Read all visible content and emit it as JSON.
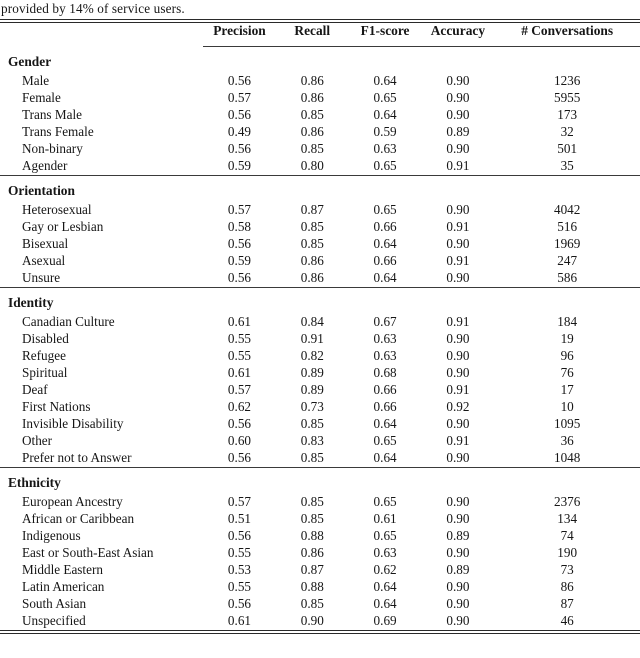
{
  "caption": {
    "text": "provided by 14% of service users."
  },
  "table": {
    "columns": [
      {
        "key": "label",
        "label": ""
      },
      {
        "key": "precision",
        "label": "Precision"
      },
      {
        "key": "recall",
        "label": "Recall"
      },
      {
        "key": "f1",
        "label": "F1-score"
      },
      {
        "key": "accuracy",
        "label": "Accuracy"
      },
      {
        "key": "conv",
        "label": "# Conversations"
      }
    ],
    "sections": [
      {
        "title": "Gender",
        "rows": [
          {
            "label": "Male",
            "precision": "0.56",
            "recall": "0.86",
            "f1": "0.64",
            "accuracy": "0.90",
            "conv": "1236"
          },
          {
            "label": "Female",
            "precision": "0.57",
            "recall": "0.86",
            "f1": "0.65",
            "accuracy": "0.90",
            "conv": "5955"
          },
          {
            "label": "Trans Male",
            "precision": "0.56",
            "recall": "0.85",
            "f1": "0.64",
            "accuracy": "0.90",
            "conv": "173"
          },
          {
            "label": "Trans Female",
            "precision": "0.49",
            "recall": "0.86",
            "f1": "0.59",
            "accuracy": "0.89",
            "conv": "32"
          },
          {
            "label": "Non-binary",
            "precision": "0.56",
            "recall": "0.85",
            "f1": "0.63",
            "accuracy": "0.90",
            "conv": "501"
          },
          {
            "label": "Agender",
            "precision": "0.59",
            "recall": "0.80",
            "f1": "0.65",
            "accuracy": "0.91",
            "conv": "35"
          }
        ]
      },
      {
        "title": "Orientation",
        "rows": [
          {
            "label": "Heterosexual",
            "precision": "0.57",
            "recall": "0.87",
            "f1": "0.65",
            "accuracy": "0.90",
            "conv": "4042"
          },
          {
            "label": "Gay or Lesbian",
            "precision": "0.58",
            "recall": "0.85",
            "f1": "0.66",
            "accuracy": "0.91",
            "conv": "516"
          },
          {
            "label": "Bisexual",
            "precision": "0.56",
            "recall": "0.85",
            "f1": "0.64",
            "accuracy": "0.90",
            "conv": "1969"
          },
          {
            "label": "Asexual",
            "precision": "0.59",
            "recall": "0.86",
            "f1": "0.66",
            "accuracy": "0.91",
            "conv": "247"
          },
          {
            "label": "Unsure",
            "precision": "0.56",
            "recall": "0.86",
            "f1": "0.64",
            "accuracy": "0.90",
            "conv": "586"
          }
        ]
      },
      {
        "title": "Identity",
        "rows": [
          {
            "label": "Canadian Culture",
            "precision": "0.61",
            "recall": "0.84",
            "f1": "0.67",
            "accuracy": "0.91",
            "conv": "184"
          },
          {
            "label": "Disabled",
            "precision": "0.55",
            "recall": "0.91",
            "f1": "0.63",
            "accuracy": "0.90",
            "conv": "19"
          },
          {
            "label": "Refugee",
            "precision": "0.55",
            "recall": "0.82",
            "f1": "0.63",
            "accuracy": "0.90",
            "conv": "96"
          },
          {
            "label": "Spiritual",
            "precision": "0.61",
            "recall": "0.89",
            "f1": "0.68",
            "accuracy": "0.90",
            "conv": "76"
          },
          {
            "label": "Deaf",
            "precision": "0.57",
            "recall": "0.89",
            "f1": "0.66",
            "accuracy": "0.91",
            "conv": "17"
          },
          {
            "label": "First Nations",
            "precision": "0.62",
            "recall": "0.73",
            "f1": "0.66",
            "accuracy": "0.92",
            "conv": "10"
          },
          {
            "label": "Invisible Disability",
            "precision": "0.56",
            "recall": "0.85",
            "f1": "0.64",
            "accuracy": "0.90",
            "conv": "1095"
          },
          {
            "label": "Other",
            "precision": "0.60",
            "recall": "0.83",
            "f1": "0.65",
            "accuracy": "0.91",
            "conv": "36"
          },
          {
            "label": "Prefer not to Answer",
            "precision": "0.56",
            "recall": "0.85",
            "f1": "0.64",
            "accuracy": "0.90",
            "conv": "1048"
          }
        ]
      },
      {
        "title": "Ethnicity",
        "rows": [
          {
            "label": "European Ancestry",
            "precision": "0.57",
            "recall": "0.85",
            "f1": "0.65",
            "accuracy": "0.90",
            "conv": "2376"
          },
          {
            "label": "African or Caribbean",
            "precision": "0.51",
            "recall": "0.85",
            "f1": "0.61",
            "accuracy": "0.90",
            "conv": "134"
          },
          {
            "label": "Indigenous",
            "precision": "0.56",
            "recall": "0.88",
            "f1": "0.65",
            "accuracy": "0.89",
            "conv": "74"
          },
          {
            "label": "East or South-East Asian",
            "precision": "0.55",
            "recall": "0.86",
            "f1": "0.63",
            "accuracy": "0.90",
            "conv": "190"
          },
          {
            "label": "Middle Eastern",
            "precision": "0.53",
            "recall": "0.87",
            "f1": "0.62",
            "accuracy": "0.89",
            "conv": "73"
          },
          {
            "label": "Latin American",
            "precision": "0.55",
            "recall": "0.88",
            "f1": "0.64",
            "accuracy": "0.90",
            "conv": "86"
          },
          {
            "label": "South Asian",
            "precision": "0.56",
            "recall": "0.85",
            "f1": "0.64",
            "accuracy": "0.90",
            "conv": "87"
          },
          {
            "label": "Unspecified",
            "precision": "0.61",
            "recall": "0.90",
            "f1": "0.69",
            "accuracy": "0.90",
            "conv": "46"
          }
        ]
      }
    ]
  }
}
